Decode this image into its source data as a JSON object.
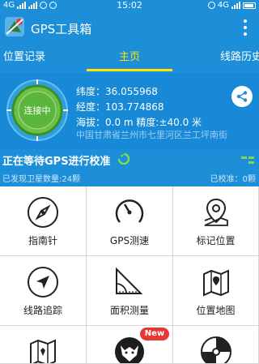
{
  "status_bar": {
    "network_left": "4G",
    "time": "15:02",
    "network_right": "4G"
  },
  "header": {
    "title": "GPS工具箱"
  },
  "tabs": [
    {
      "label": "位置记录"
    },
    {
      "label": "主页"
    },
    {
      "label": "线路历史"
    }
  ],
  "info": {
    "status": "连接中",
    "latitude": "纬度：36.055968",
    "longitude": "经度：103.774868",
    "altitude_accuracy": "海拔：0.0 m    精度:±40.0 米",
    "address": "中国甘肃省兰州市七里河区兰工坪南街"
  },
  "gps": {
    "waiting_text": "正在等待GPS进行校准",
    "satellites_found": "已发现卫星数量:24颗",
    "satellites_calibrated": "已校准：0颗"
  },
  "tools": [
    {
      "label": "指南针",
      "icon": "compass-icon"
    },
    {
      "label": "GPS测速",
      "icon": "speedometer-icon"
    },
    {
      "label": "标记位置",
      "icon": "map-pin-icon"
    },
    {
      "label": "线路追踪",
      "icon": "navigation-arrow-icon"
    },
    {
      "label": "面积测量",
      "icon": "protractor-icon"
    },
    {
      "label": "位置地图",
      "icon": "folded-map-icon"
    },
    {
      "label": "",
      "icon": "map-icon"
    },
    {
      "label": "",
      "icon": "wolf-icon",
      "badge": "New"
    },
    {
      "label": "",
      "icon": "disc-icon"
    }
  ],
  "colors": {
    "primary": "#1c8fd8",
    "accent": "#ffe500",
    "badge": "#e53935"
  }
}
